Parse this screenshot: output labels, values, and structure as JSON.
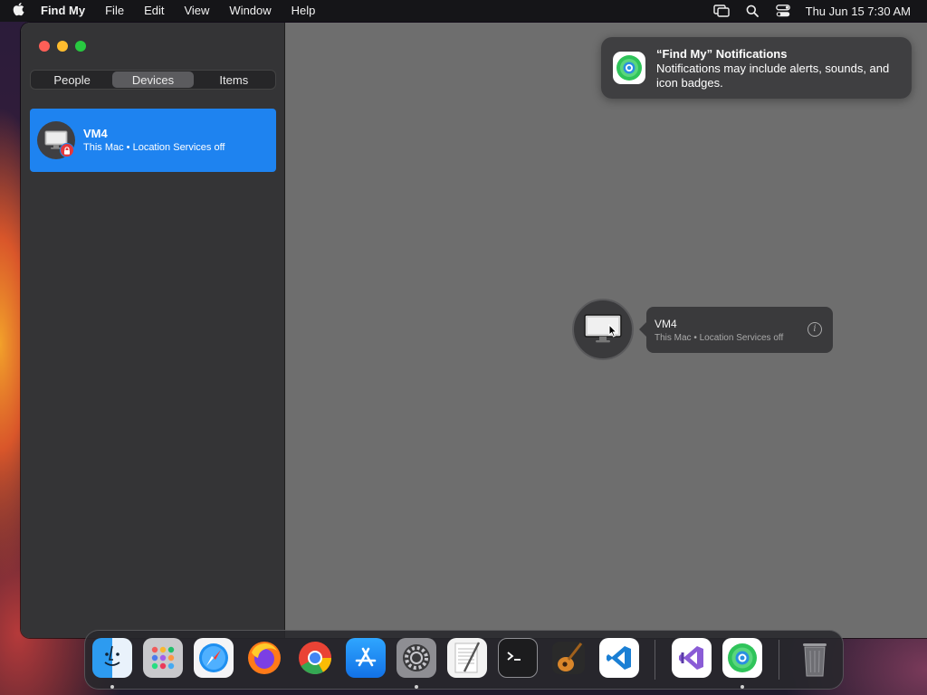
{
  "menubar": {
    "app_name": "Find My",
    "menus": [
      "File",
      "Edit",
      "View",
      "Window",
      "Help"
    ],
    "clock": "Thu Jun 15  7:30 AM"
  },
  "sidebar": {
    "tabs": [
      "People",
      "Devices",
      "Items"
    ],
    "selected_tab": "Devices",
    "devices": [
      {
        "name": "VM4",
        "subtitle": "This Mac • Location Services off"
      }
    ]
  },
  "map": {
    "callout": {
      "name": "VM4",
      "subtitle": "This Mac • Location Services off"
    }
  },
  "notification": {
    "title": "“Find My” Notifications",
    "body": "Notifications may include alerts, sounds, and icon badges."
  },
  "dock": {
    "apps": [
      "finder-icon",
      "launchpad-icon",
      "safari-icon",
      "firefox-icon",
      "chrome-icon",
      "app-store-icon",
      "system-settings-icon",
      "textedit-icon",
      "terminal-icon",
      "garageband-icon",
      "vscode-icon",
      "visual-studio-icon",
      "find-my-icon",
      "trash-icon"
    ]
  },
  "colors": {
    "selection": "#1e83f0",
    "sidebar_bg": "#343436",
    "map_bg": "#6e6e6e"
  }
}
